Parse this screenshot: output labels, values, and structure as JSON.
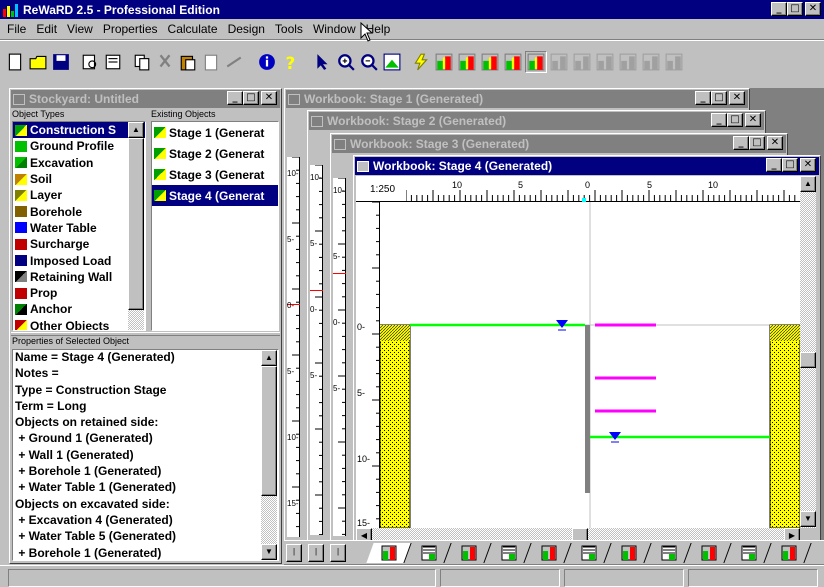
{
  "app": {
    "title": "ReWaRD 2.5 - Professional Edition"
  },
  "menu": [
    "File",
    "Edit",
    "View",
    "Properties",
    "Calculate",
    "Design",
    "Tools",
    "Window",
    "Help"
  ],
  "colors": {
    "titlebar": "#000080",
    "inactive": "#808080",
    "soil": "#ffff00",
    "ground": "#00ff00",
    "prop": "#ff00ff",
    "water": "#0000ff",
    "wall": "#808080"
  },
  "toolbar": {
    "icons": [
      "new-icon",
      "open-icon",
      "save-icon",
      "print-preview-icon",
      "print-icon",
      "copy-icon",
      "cut-icon",
      "paste-icon",
      "clipboard-icon",
      "delete-icon",
      "info-icon",
      "help-icon",
      "pointer-icon",
      "zoom-in-icon",
      "zoom-out-icon",
      "zoom-fit-icon",
      "run-icon",
      "stage-icon-1",
      "stage-icon-2",
      "stage-icon-3",
      "stage-icon-4",
      "stage-icon-5",
      "stage-icon-6",
      "stage-icon-7",
      "stage-icon-8",
      "stage-icon-9",
      "stage-icon-10",
      "stage-icon-11"
    ]
  },
  "stockyard": {
    "title": "Stockyard: Untitled",
    "object_types_label": "Object Types",
    "existing_objects_label": "Existing Objects",
    "types": [
      {
        "label": "Construction S",
        "icon": "construction-stage-icon",
        "selected": true
      },
      {
        "label": "Ground Profile",
        "icon": "ground-profile-icon"
      },
      {
        "label": "Excavation",
        "icon": "excavation-icon"
      },
      {
        "label": "Soil",
        "icon": "soil-icon"
      },
      {
        "label": "Layer",
        "icon": "layer-icon"
      },
      {
        "label": "Borehole",
        "icon": "borehole-icon"
      },
      {
        "label": "Water Table",
        "icon": "water-table-icon"
      },
      {
        "label": "Surcharge",
        "icon": "surcharge-icon"
      },
      {
        "label": "Imposed Load",
        "icon": "imposed-load-icon"
      },
      {
        "label": "Retaining Wall",
        "icon": "retaining-wall-icon"
      },
      {
        "label": "Prop",
        "icon": "prop-icon"
      },
      {
        "label": "Anchor",
        "icon": "anchor-icon"
      },
      {
        "label": "Other Objects",
        "icon": "other-objects-icon"
      }
    ],
    "existing": [
      {
        "label": "Stage 1 (Generat"
      },
      {
        "label": "Stage 2 (Generat"
      },
      {
        "label": "Stage 3 (Generat"
      },
      {
        "label": "Stage 4 (Generat",
        "selected": true
      }
    ],
    "properties_label": "Properties of Selected Object",
    "properties": [
      "Name = Stage 4 (Generated)",
      "Notes =",
      "Type = Construction Stage",
      "Term = Long",
      "Objects on retained side:",
      " + Ground 1 (Generated)",
      " + Wall 1 (Generated)",
      " + Borehole 1 (Generated)",
      " + Water Table 1 (Generated)",
      "Objects on excavated side:",
      " + Excavation 4 (Generated)",
      " + Water Table 5 (Generated)",
      " + Borehole 1 (Generated)"
    ]
  },
  "workbooks": [
    {
      "title": "Workbook: Stage 1 (Generated)"
    },
    {
      "title": "Workbook: Stage 2 (Generated)"
    },
    {
      "title": "Workbook: Stage 3 (Generated)"
    },
    {
      "title": "Workbook: Stage 4 (Generated)"
    }
  ],
  "drawing": {
    "scale": "1:250",
    "hruler_labels": [
      "10",
      "5",
      "0",
      "5",
      "10"
    ],
    "vruler_labels": [
      "0-",
      "5-",
      "10-",
      "15-"
    ],
    "bg_vruler_labels": [
      "10-",
      "5-",
      "0-",
      "5-",
      "10-",
      "15-"
    ]
  },
  "status_bar": [
    "",
    "",
    "",
    ""
  ]
}
